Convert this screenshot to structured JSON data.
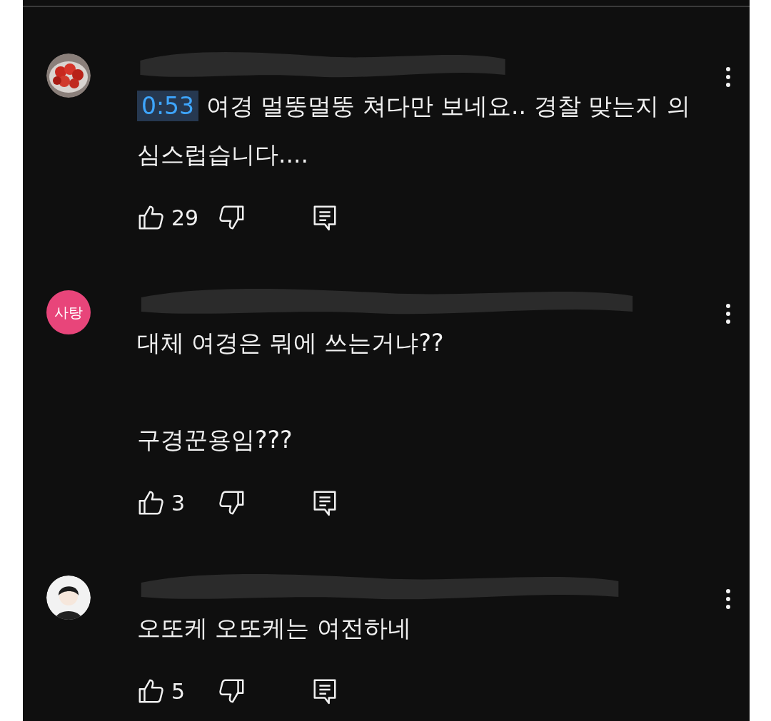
{
  "comments": [
    {
      "avatar": {
        "kind": "picture"
      },
      "author": {
        "redacted": true
      },
      "timestamp": "0:53",
      "paragraphs": [
        "여경 멀뚱멀뚱 쳐다만 보네요.. 경찰 맞는지 의심스럽습니다...."
      ],
      "likes": "29"
    },
    {
      "avatar": {
        "kind": "initials",
        "label": "사탕",
        "color": "#e8457a"
      },
      "author": {
        "redacted": true
      },
      "paragraphs": [
        "대체 여경은 뭐에 쓰는거냐??",
        "구경꾼용임???"
      ],
      "likes": "3"
    },
    {
      "avatar": {
        "kind": "figure"
      },
      "author": {
        "redacted": true
      },
      "paragraphs": [
        "오또케 오또케는 여전하네"
      ],
      "likes": "5"
    }
  ]
}
